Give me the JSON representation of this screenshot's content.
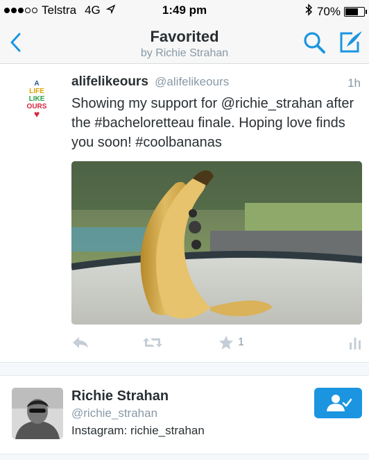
{
  "status_bar": {
    "carrier": "Telstra",
    "network": "4G",
    "time": "1:49 pm",
    "battery": "70%",
    "battery_level": 0.7,
    "signal_bars_filled": 3,
    "signal_bars_total": 5
  },
  "nav": {
    "title": "Favorited",
    "subtitle": "by Richie Strahan",
    "back_icon": "chevron-left-icon",
    "search_icon": "search-icon",
    "compose_icon": "compose-icon",
    "accent_color": "#1b95e0"
  },
  "tweet": {
    "avatar_logo": [
      "A",
      "LIFE",
      "LIKE",
      "OURS"
    ],
    "author_name": "alifelikeours",
    "author_handle": "@alifelikeours",
    "time": "1h",
    "text": "Showing my support for @richie_strahan after the #bacheloretteau finale. Hoping love finds you soon! #coolbananas",
    "actions": {
      "reply_icon": "reply-icon",
      "retweet_icon": "retweet-icon",
      "favorite_icon": "star-icon",
      "favorite_count": "1",
      "stats_icon": "bar-chart-icon"
    }
  },
  "user_card": {
    "name": "Richie Strahan",
    "handle": "@richie_strahan",
    "bio": "Instagram: richie_strahan",
    "follow_icon": "follow-user-icon"
  }
}
